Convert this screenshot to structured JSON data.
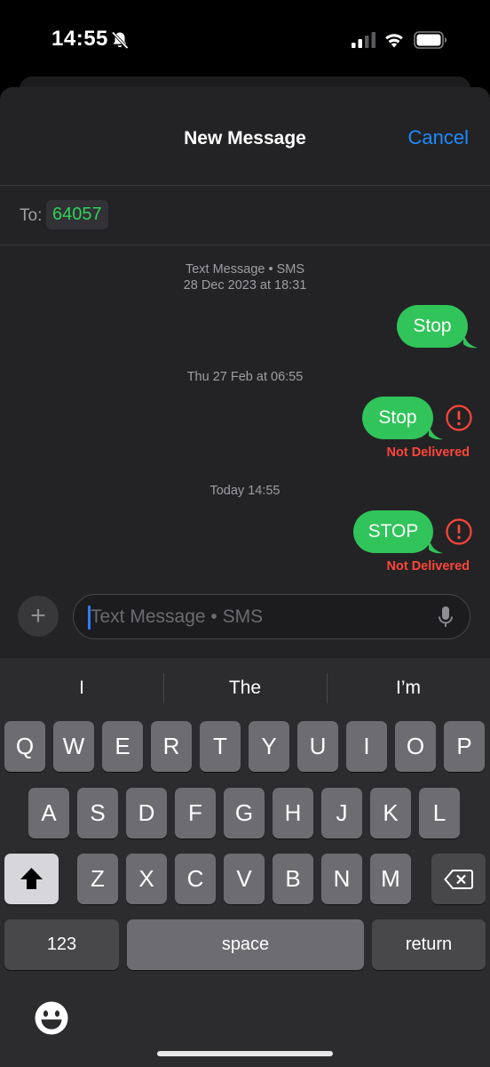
{
  "status_bar": {
    "time": "14:55",
    "bell_icon": "bell-slash-icon",
    "signal_icon": "cellular-signal-icon",
    "wifi_icon": "wifi-icon",
    "battery_icon": "battery-icon"
  },
  "header": {
    "title": "New Message",
    "cancel_label": "Cancel"
  },
  "recipient": {
    "to_label": "To:",
    "number": "64057"
  },
  "conversation": {
    "service_label": "Text Message • SMS",
    "groups": [
      {
        "timestamp": "28 Dec 2023 at 18:31",
        "message": "Stop",
        "status": ""
      },
      {
        "timestamp": "Thu 27 Feb at 06:55",
        "message": "Stop",
        "status": "Not Delivered"
      },
      {
        "timestamp": "Today 14:55",
        "message": "STOP",
        "status": "Not Delivered"
      }
    ]
  },
  "composer": {
    "placeholder": "Text Message • SMS",
    "add_icon": "plus-icon",
    "mic_icon": "microphone-icon"
  },
  "keyboard": {
    "suggestions": [
      "I",
      "The",
      "I’m"
    ],
    "row1": [
      "Q",
      "W",
      "E",
      "R",
      "T",
      "Y",
      "U",
      "I",
      "O",
      "P"
    ],
    "row2": [
      "A",
      "S",
      "D",
      "F",
      "G",
      "H",
      "J",
      "K",
      "L"
    ],
    "row3": [
      "Z",
      "X",
      "C",
      "V",
      "B",
      "N",
      "M"
    ],
    "numbers_label": "123",
    "space_label": "space",
    "return_label": "return",
    "shift_icon": "shift-icon",
    "delete_icon": "delete-backward-icon",
    "emoji_icon": "emoji-icon"
  },
  "colors": {
    "bubble": "#30c45a",
    "link": "#1d8bff",
    "error": "#ff453a",
    "recipient": "#30d158"
  }
}
